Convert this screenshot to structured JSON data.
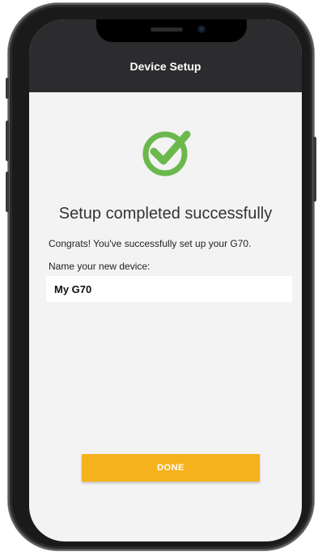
{
  "nav": {
    "title": "Device Setup"
  },
  "status": {
    "icon": "check-circle-icon",
    "color": "#6bb84d",
    "headline": "Setup completed successfully"
  },
  "main": {
    "congrats_text": "Congrats! You've successfully set up your G70.",
    "name_label": "Name your new device:",
    "name_value": "My G70"
  },
  "actions": {
    "done_label": "DONE",
    "accent_color": "#f6b21c"
  }
}
